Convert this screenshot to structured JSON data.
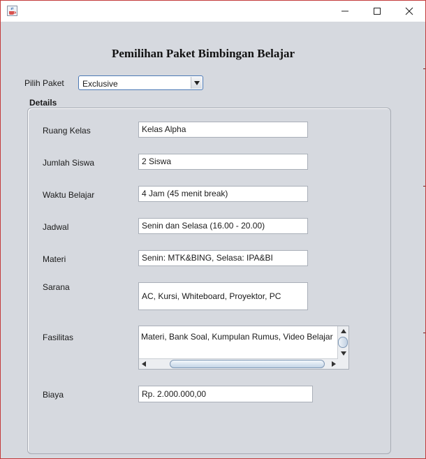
{
  "window": {
    "app_icon": "java-cup-icon",
    "controls": [
      "minimize-icon",
      "maximize-icon",
      "close-icon"
    ]
  },
  "form": {
    "heading": "Pemilihan Paket Bimbingan Belajar",
    "paket_label": "Pilih Paket",
    "paket_value": "Exclusive",
    "details_title": "Details"
  },
  "details": {
    "ruang_kelas": {
      "label": "Ruang Kelas",
      "value": "Kelas Alpha"
    },
    "jumlah_siswa": {
      "label": "Jumlah Siswa",
      "value": "2 Siswa"
    },
    "waktu_belajar": {
      "label": "Waktu Belajar",
      "value": "4 Jam (45 menit break)"
    },
    "jadwal": {
      "label": "Jadwal",
      "value": "Senin dan Selasa (16.00 - 20.00)"
    },
    "materi": {
      "label": "Materi",
      "value": "Senin: MTK&BING, Selasa: IPA&BI"
    },
    "sarana": {
      "label": "Sarana",
      "value": "AC, Kursi, Whiteboard, Proyektor, PC"
    },
    "fasilitas": {
      "label": "Fasilitas",
      "value": "Materi, Bank Soal, Kumpulan Rumus, Video Belajar"
    },
    "biaya": {
      "label": "Biaya",
      "value": "Rp. 2.000.000,00"
    }
  }
}
